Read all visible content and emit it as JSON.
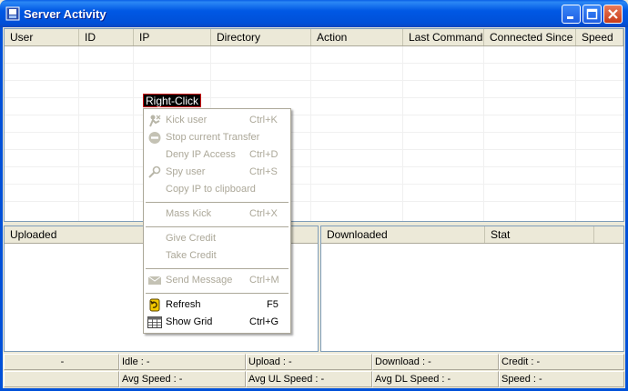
{
  "window": {
    "title": "Server Activity",
    "accent": "#0050D8"
  },
  "main_list": {
    "columns": [
      "User",
      "ID",
      "IP",
      "Directory",
      "Action",
      "Last Command",
      "Connected Since",
      "Speed"
    ]
  },
  "context_menu": {
    "trigger_label": "Right-Click",
    "items": [
      {
        "label": "Kick user",
        "shortcut": "Ctrl+K",
        "enabled": false,
        "icon": "kick-icon"
      },
      {
        "label": "Stop current Transfer",
        "shortcut": "",
        "enabled": false,
        "icon": "stop-icon"
      },
      {
        "label": "Deny IP Access",
        "shortcut": "Ctrl+D",
        "enabled": false,
        "icon": ""
      },
      {
        "label": "Spy user",
        "shortcut": "Ctrl+S",
        "enabled": false,
        "icon": "magnifier-icon"
      },
      {
        "label": "Copy IP to clipboard",
        "shortcut": "",
        "enabled": false,
        "icon": ""
      },
      {
        "label": "Mass Kick",
        "shortcut": "Ctrl+X",
        "enabled": false,
        "icon": ""
      },
      {
        "label": "Give Credit",
        "shortcut": "",
        "enabled": false,
        "icon": ""
      },
      {
        "label": "Take Credit",
        "shortcut": "",
        "enabled": false,
        "icon": ""
      },
      {
        "label": "Send Message",
        "shortcut": "Ctrl+M",
        "enabled": false,
        "icon": "message-icon"
      },
      {
        "label": "Refresh",
        "shortcut": "F5",
        "enabled": true,
        "icon": "refresh-icon"
      },
      {
        "label": "Show Grid",
        "shortcut": "Ctrl+G",
        "enabled": true,
        "icon": "grid-icon"
      }
    ]
  },
  "uploaded_panel": {
    "columns": [
      "Uploaded"
    ]
  },
  "downloaded_panel": {
    "columns": [
      "Downloaded",
      "Stat"
    ]
  },
  "status_bar": {
    "row1": [
      "-",
      "Idle : -",
      "Upload : -",
      "Download : -",
      "Credit : -"
    ],
    "row2": [
      "",
      "Avg Speed : -",
      "Avg UL Speed : -",
      "Avg DL Speed : -",
      "Speed : -"
    ]
  }
}
